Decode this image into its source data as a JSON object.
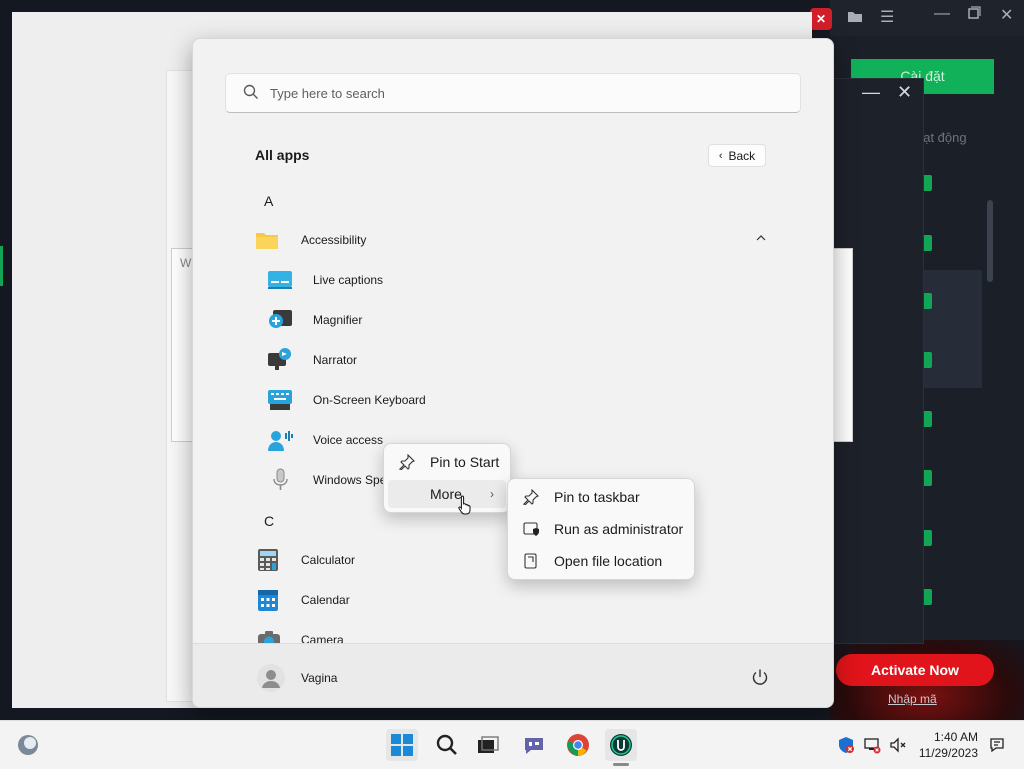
{
  "start_menu": {
    "search": {
      "placeholder": "Type here to search"
    },
    "all_apps_title": "All apps",
    "back_label": "Back",
    "groups": [
      {
        "letter": "A"
      },
      {
        "letter": "C"
      }
    ],
    "apps": {
      "accessibility": "Accessibility",
      "live_captions": "Live captions",
      "magnifier": "Magnifier",
      "narrator": "Narrator",
      "on_screen_keyboard": "On-Screen Keyboard",
      "voice_access": "Voice access",
      "windows_speech": "Windows Spe",
      "calculator": "Calculator",
      "calendar": "Calendar",
      "camera": "Camera"
    },
    "user_name": "Vagina"
  },
  "context_menu": {
    "pin_to_start": "Pin to Start",
    "more": "More"
  },
  "submenu": {
    "pin_to_taskbar": "Pin to taskbar",
    "run_as_admin": "Run as administrator",
    "open_file_location": "Open file location"
  },
  "background_app": {
    "button": "Cài đặt",
    "status": "oạt động",
    "activate": "Activate Now",
    "link": "Nhập mã"
  },
  "taskbar": {
    "time": "1:40 AM",
    "date": "11/29/2023"
  },
  "colors": {
    "start_bg": "#f2f2f2",
    "accent_green": "#12a556",
    "activate_red": "#e0141a",
    "folder_yellow": "#f7c948",
    "app_blue": "#1e9ad6"
  }
}
